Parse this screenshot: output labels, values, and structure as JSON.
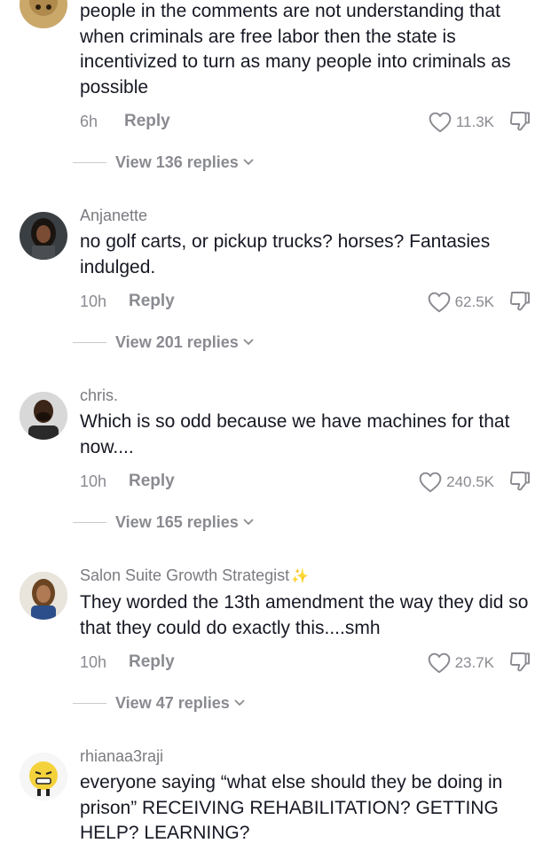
{
  "comments": [
    {
      "username": "",
      "text": "people in the comments are not understanding that when criminals are free labor then the state is incentivized to turn as many people into criminals as possible",
      "time": "6h",
      "reply": "Reply",
      "likes": "11.3K",
      "view_replies": "View 136 replies"
    },
    {
      "username": "Anjanette",
      "text": "no golf carts, or pickup trucks? horses? Fantasies indulged.",
      "time": "10h",
      "reply": "Reply",
      "likes": "62.5K",
      "view_replies": "View 201 replies"
    },
    {
      "username": "chris.",
      "text": "Which is so odd because we have machines for that now....",
      "time": "10h",
      "reply": "Reply",
      "likes": "240.5K",
      "view_replies": "View 165 replies"
    },
    {
      "username": "Salon Suite Growth Strategist",
      "username_badge": "✨",
      "text": "They worded the 13th amendment the way they did so that they could do exactly this....smh",
      "time": "10h",
      "reply": "Reply",
      "likes": "23.7K",
      "view_replies": "View 47 replies"
    },
    {
      "username": "rhianaa3raji",
      "text": "everyone saying “what else should they be doing in prison” RECEIVING REHABILITATION? GETTING HELP? LEARNING?"
    }
  ],
  "icons": {
    "like": "heart-outline-icon",
    "dislike": "thumbs-down-icon",
    "expand": "chevron-down-icon"
  },
  "colors": {
    "text": "#161823",
    "secondary": "#8a8b91",
    "sparkle": "#f2c94c"
  }
}
